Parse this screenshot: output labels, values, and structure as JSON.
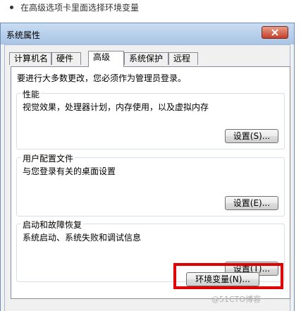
{
  "instruction": "在高级选项卡里面选择环境变量",
  "dialog": {
    "title": "系统属性",
    "close_icon": "close-icon",
    "tabs": [
      {
        "label": "计算机名",
        "active": false
      },
      {
        "label": "硬件",
        "active": false
      },
      {
        "label": "高级",
        "active": true
      },
      {
        "label": "系统保护",
        "active": false
      },
      {
        "label": "远程",
        "active": false
      }
    ],
    "admin_note": "要进行大多数更改，您必须作为管理员登录。",
    "groups": [
      {
        "title": "性能",
        "description": "视觉效果，处理器计划，内存使用，以及虚拟内存",
        "button": "设置(S)..."
      },
      {
        "title": "用户配置文件",
        "description": "与您登录有关的桌面设置",
        "button": "设置(E)..."
      },
      {
        "title": "启动和故障恢复",
        "description": "系统启动、系统失败和调试信息",
        "button": "设置(T)..."
      }
    ],
    "env_button": "环境变量(N)..."
  },
  "highlight_color": "#e00000",
  "watermark": "@51CTO博客"
}
